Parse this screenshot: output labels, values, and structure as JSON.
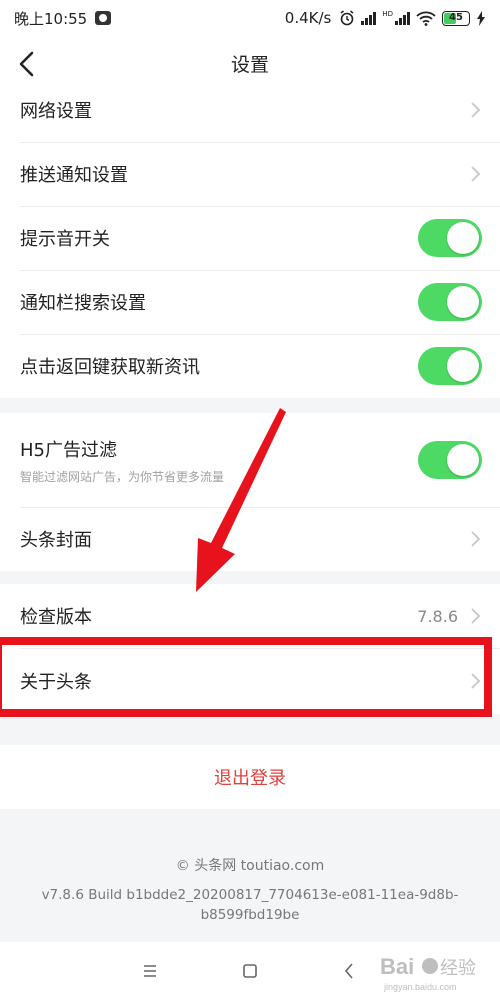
{
  "status_bar": {
    "time": "晚上10:55",
    "speed": "0.4K/s",
    "hd_label": "HD",
    "battery_level": "45",
    "battery_fraction": 0.45,
    "icons": [
      "app-icon",
      "alarm-icon",
      "signal-icon",
      "hd-signal-icon",
      "wifi-icon",
      "battery-icon",
      "charging-icon"
    ]
  },
  "title_bar": {
    "back_icon": "chevron-left-icon",
    "title": "设置"
  },
  "groups": [
    {
      "rows": [
        {
          "label": "网络设置",
          "control": "chevron"
        },
        {
          "label": "推送通知设置",
          "control": "chevron"
        },
        {
          "label": "提示音开关",
          "control": "toggle",
          "on": true
        },
        {
          "label": "通知栏搜索设置",
          "control": "toggle",
          "on": true
        },
        {
          "label": "点击返回键获取新资讯",
          "control": "toggle",
          "on": true
        }
      ]
    },
    {
      "rows": [
        {
          "label": "H5广告过滤",
          "sublabel": "智能过滤网站广告，为你节省更多流量",
          "control": "toggle",
          "on": true
        },
        {
          "label": "头条封面",
          "control": "chevron"
        }
      ]
    },
    {
      "rows": [
        {
          "label": "检查版本",
          "value": "7.8.6",
          "control": "chevron"
        },
        {
          "label": "关于头条",
          "control": "chevron"
        }
      ]
    }
  ],
  "logout": {
    "label": "退出登录",
    "color": "#e1413c"
  },
  "footer": {
    "copyright": "© 头条网 toutiao.com",
    "build": "v7.8.6 Build b1bdde2_20200817_7704613e-e081-11ea-9d8b-b8599fbd19be"
  },
  "nav_bar": {
    "icons": [
      "menu-icon",
      "home-icon",
      "back-icon"
    ]
  },
  "watermark": {
    "brand": "Baidu经验",
    "url": "jingyan.baidu.com"
  },
  "colors": {
    "toggle_on": "#4cd964",
    "annotation_red": "#e8121c",
    "background": "#f4f5f6"
  }
}
